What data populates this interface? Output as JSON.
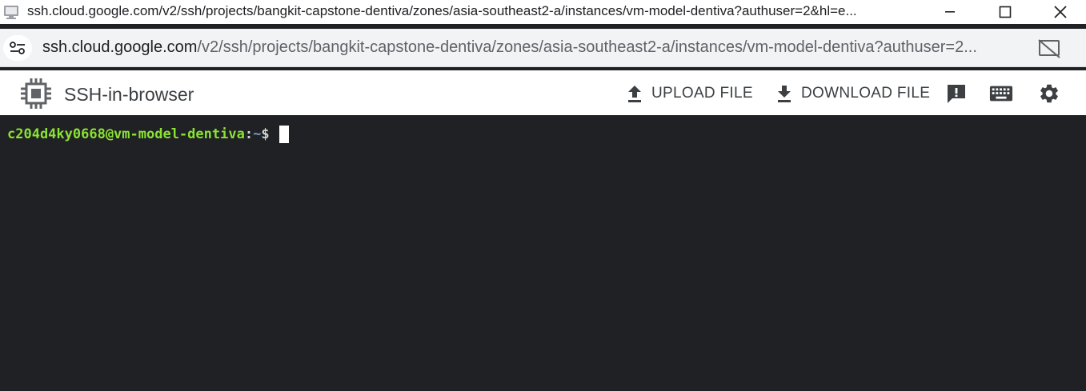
{
  "window": {
    "title": "ssh.cloud.google.com/v2/ssh/projects/bangkit-capstone-dentiva/zones/asia-southeast2-a/instances/vm-model-dentiva?authuser=2&hl=e..."
  },
  "address_bar": {
    "host": "ssh.cloud.google.com",
    "path": "/v2/ssh/projects/bangkit-capstone-dentiva/zones/asia-southeast2-a/instances/vm-model-dentiva?authuser=2..."
  },
  "toolbar": {
    "app_title": "SSH-in-browser",
    "upload_label": "UPLOAD FILE",
    "download_label": "DOWNLOAD FILE"
  },
  "terminal": {
    "user_host": "c204d4ky0668@vm-model-dentiva",
    "separator": ":",
    "path": "~",
    "prompt_symbol": "$"
  },
  "colors": {
    "terminal_bg": "#202124",
    "prompt_user": "#8ae234",
    "prompt_path": "#729fcf"
  }
}
